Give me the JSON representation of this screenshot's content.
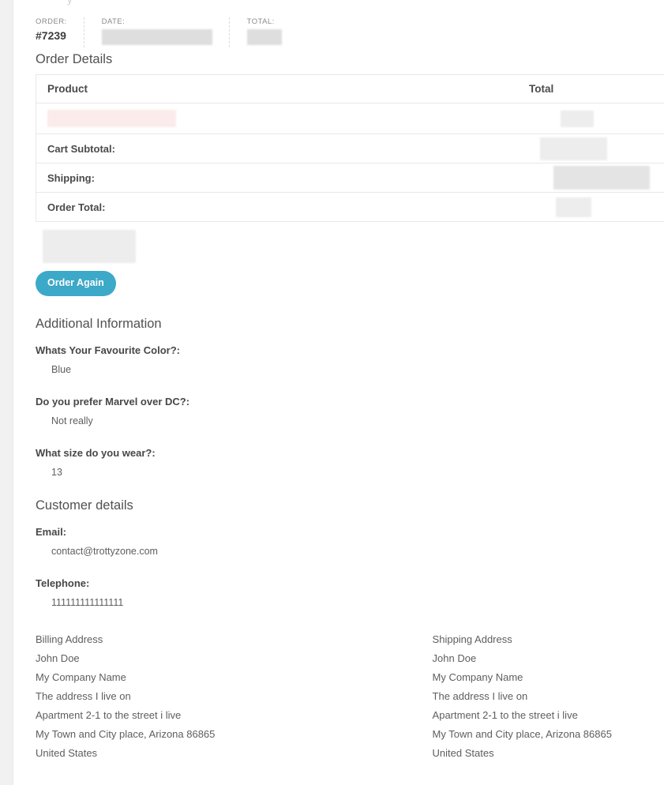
{
  "top_clipped_text": "y",
  "order_meta": [
    {
      "label": "ORDER:",
      "value": "#7239",
      "redacted": false
    },
    {
      "label": "DATE:",
      "value": "",
      "redacted": true
    },
    {
      "label": "TOTAL:",
      "value": "",
      "redacted": true
    }
  ],
  "order_details": {
    "heading": "Order Details",
    "columns": {
      "product": "Product",
      "total": "Total"
    },
    "product_row": {
      "name_redacted": true,
      "total_redacted": true
    },
    "summary_rows": [
      {
        "label": "Cart Subtotal:",
        "total_redacted": true
      },
      {
        "label": "Shipping:",
        "total_redacted": true
      },
      {
        "label": "Order Total:",
        "total_redacted": true
      }
    ]
  },
  "actions": {
    "order_again_label": "Order Again"
  },
  "additional_information": {
    "heading": "Additional Information",
    "fields": [
      {
        "label": "Whats Your Favourite Color?:",
        "value": "Blue"
      },
      {
        "label": "Do you prefer Marvel over DC?:",
        "value": "Not really"
      },
      {
        "label": "What size do you wear?:",
        "value": "13"
      }
    ]
  },
  "customer_details": {
    "heading": "Customer details",
    "fields": [
      {
        "label": "Email:",
        "value": "contact@trottyzone.com"
      },
      {
        "label": "Telephone:",
        "value": "111111111111111"
      }
    ]
  },
  "addresses": {
    "billing": {
      "title": "Billing Address",
      "lines": [
        "John Doe",
        "My Company Name",
        "The address I live on",
        "Apartment 2-1 to the street i live",
        "My Town and City place, Arizona 86865",
        "United States"
      ]
    },
    "shipping": {
      "title": "Shipping Address",
      "lines": [
        "John Doe",
        "My Company Name",
        "The address I live on",
        "Apartment 2-1 to the street i live",
        "My Town and City place, Arizona 86865",
        "United States"
      ]
    }
  },
  "colors": {
    "accent": "#3da9c8",
    "page_background": "#f1f1f1",
    "content_background": "#ffffff",
    "border": "#e8e8e8",
    "heading_text": "#515151",
    "body_text": "#5e5e5e",
    "redaction_gray": "#dedede",
    "redaction_pink": "#fbebeb"
  }
}
